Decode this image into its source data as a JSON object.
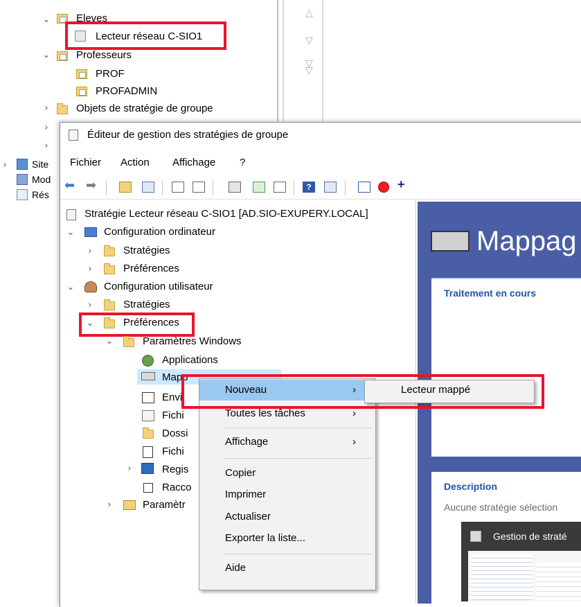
{
  "bg_tree": {
    "eleves": "Eleves",
    "lecteur": "Lecteur réseau C-SIO1",
    "professeurs": "Professeurs",
    "prof": "PROF",
    "profadmin": "PROFADMIN",
    "objets": "Objets de stratégie de groupe",
    "sites": "Site",
    "mod": "Mod",
    "res": "Rés"
  },
  "window": {
    "title": "Éditeur de gestion des stratégies de groupe",
    "menu": [
      "Fichier",
      "Action",
      "Affichage",
      "?"
    ]
  },
  "tree": {
    "root": "Stratégie Lecteur réseau C-SIO1 [AD.SIO-EXUPERY.LOCAL]",
    "config_ordinateur": "Configuration ordinateur",
    "strategies1": "Stratégies",
    "preferences1": "Préférences",
    "config_utilisateur": "Configuration utilisateur",
    "strategies2": "Stratégies",
    "preferences2": "Préférences",
    "parametres_windows": "Paramètres Windows",
    "applications": "Applications",
    "mappages": "Mapp",
    "env": "Envi",
    "fichiers": "Fichi",
    "dossiers": "Dossi",
    "fichiers_ini": "Fichi",
    "registre": "Regis",
    "raccourcis": "Racco",
    "parametres": "Paramètr"
  },
  "right_panel": {
    "title": "Mappag",
    "section1": "Traitement en cours",
    "section2": "Description",
    "desc_text": "Aucune stratégie sélection",
    "thumb_title": "Gestion de straté"
  },
  "context_menu": {
    "items": [
      "Nouveau",
      "Toutes les tâches",
      "Affichage",
      "Copier",
      "Imprimer",
      "Actualiser",
      "Exporter la liste...",
      "Aide"
    ]
  },
  "submenu": {
    "item": "Lecteur mappé"
  },
  "colors": {
    "accent_red": "#e8152b",
    "panel_blue": "#4a5ea6",
    "highlight_blue": "#cce8ff",
    "menu_hover": "#99c9ef"
  }
}
